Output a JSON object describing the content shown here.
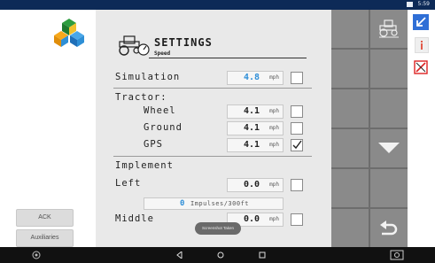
{
  "status_bar": {
    "time": "5:59"
  },
  "sidebar": {
    "ack_label": "ACK",
    "auxiliaries_label": "Auxiliaries"
  },
  "settings": {
    "title": "SETTINGS",
    "subtitle": "Speed",
    "simulation": {
      "label": "Simulation",
      "value": "4.8",
      "unit": "mph",
      "checked": false
    },
    "tractor_label": "Tractor:",
    "wheel": {
      "label": "Wheel",
      "value": "4.1",
      "unit": "mph",
      "checked": false
    },
    "ground": {
      "label": "Ground",
      "value": "4.1",
      "unit": "mph",
      "checked": false
    },
    "gps": {
      "label": "GPS",
      "value": "4.1",
      "unit": "mph",
      "checked": true
    },
    "implement_label": "Implement",
    "left": {
      "label": "Left",
      "value": "0.0",
      "unit": "mph",
      "checked": false
    },
    "impulses": {
      "value": "0",
      "unit": "Impulses/300ft"
    },
    "middle": {
      "label": "Middle",
      "value": "0.0",
      "unit": "mph",
      "checked": false
    },
    "toast": "Screenshot Taken"
  },
  "softkeys": {
    "icons": [
      "tractor-reset-icon",
      "chevron-down-icon",
      "return-icon"
    ]
  },
  "right_toolbar": {
    "icons": [
      "arrow-down-left-icon",
      "info-icon",
      "edit-icon"
    ]
  },
  "colors": {
    "accent_blue": "#2f8fd8",
    "panel": "#e9e9e9",
    "softkey_column": "#6d6d6d",
    "status_bar": "#0d2a57"
  }
}
